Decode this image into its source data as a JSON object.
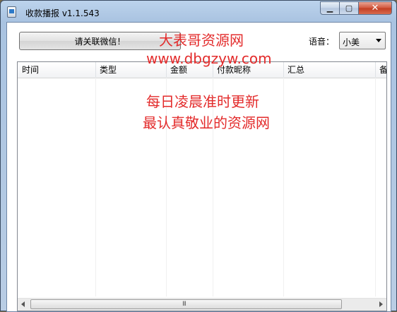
{
  "window": {
    "title": "收款播报 v1.1.543"
  },
  "caption_buttons": {
    "minimize_icon": "▁",
    "maximize_icon": "▢",
    "close_icon": "✕"
  },
  "toolbar": {
    "follow_button_label": "请关联微信！",
    "voice_label": "语音：",
    "voice_value": "小美"
  },
  "table": {
    "columns": [
      "时间",
      "类型",
      "金额",
      "付款昵称",
      "汇总",
      "备"
    ]
  },
  "watermark": {
    "line1": "大表哥资源网",
    "line2": "www.dbgzyw.com",
    "line3": "每日凌晨准时更新",
    "line4": "最认真敬业的资源网"
  },
  "scrollbar": {
    "grip": "III"
  },
  "colors": {
    "watermark": "#e32b2b",
    "titlebar": "#bcd3ec"
  }
}
